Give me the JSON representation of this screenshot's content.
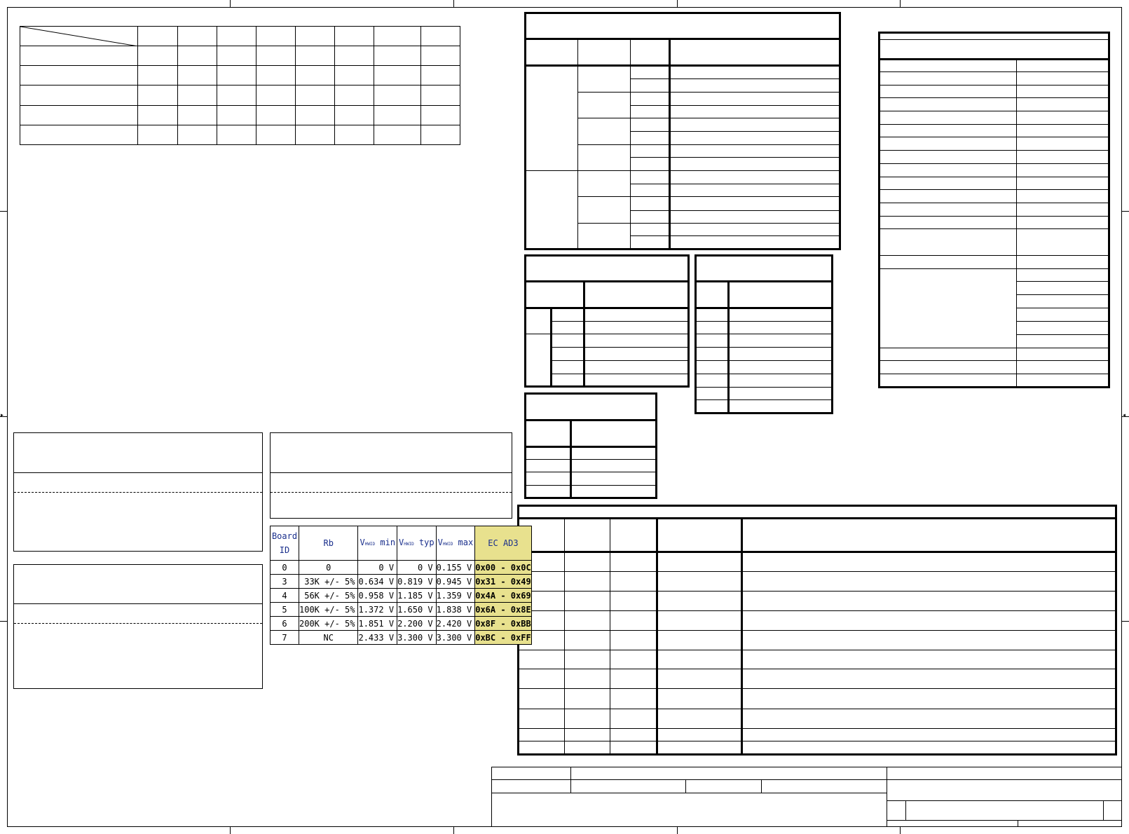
{
  "board_id_table": {
    "headers": {
      "board_id": "Board ID",
      "rb": "Rb",
      "v": "V",
      "v_sub": "HWID",
      "vmin_suffix": " min",
      "vtyp_suffix": " typ",
      "vmax_suffix": " max",
      "ec_ad3": "EC AD3"
    },
    "rows": [
      {
        "id": "0",
        "rb": "0",
        "vmin": "0 V",
        "vtyp": "0 V",
        "vmax": "0.155 V",
        "ec": "0x00 - 0x0C"
      },
      {
        "id": "3",
        "rb": "33K +/- 5%",
        "vmin": "0.634 V",
        "vtyp": "0.819 V",
        "vmax": "0.945 V",
        "ec": "0x31 - 0x49"
      },
      {
        "id": "4",
        "rb": "56K +/- 5%",
        "vmin": "0.958 V",
        "vtyp": "1.185 V",
        "vmax": "1.359 V",
        "ec": "0x4A - 0x69"
      },
      {
        "id": "5",
        "rb": "100K +/- 5%",
        "vmin": "1.372 V",
        "vtyp": "1.650 V",
        "vmax": "1.838 V",
        "ec": "0x6A - 0x8E"
      },
      {
        "id": "6",
        "rb": "200K +/- 5%",
        "vmin": "1.851 V",
        "vtyp": "2.200 V",
        "vmax": "2.420 V",
        "ec": "0x8F - 0xBB"
      },
      {
        "id": "7",
        "rb": "NC",
        "vmin": "2.433 V",
        "vtyp": "3.300 V",
        "vmax": "3.300 V",
        "ec": "0xBC - 0xFF"
      }
    ],
    "highlight_color": "#e8e18e",
    "header_text_color": "#1a2f8c"
  }
}
